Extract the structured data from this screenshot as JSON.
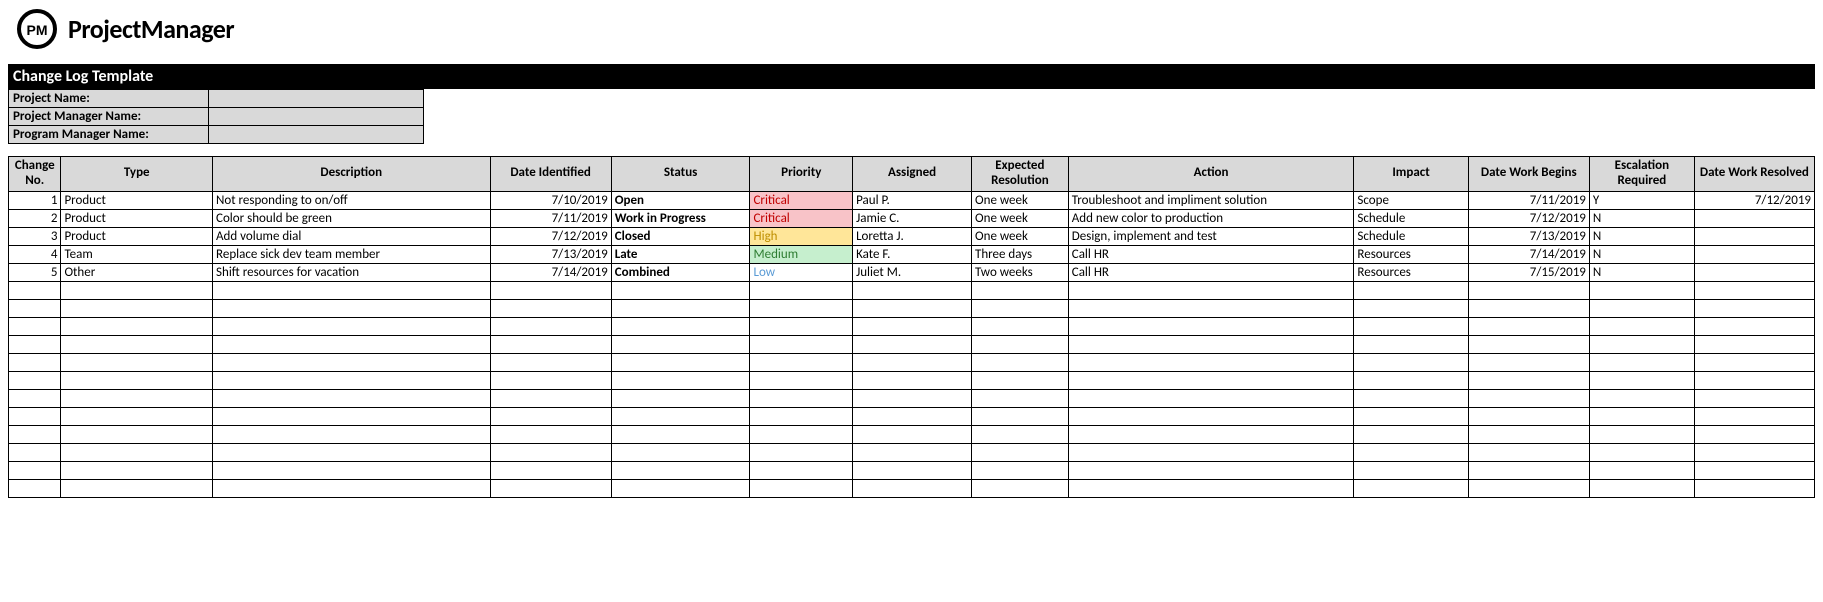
{
  "brand": "ProjectManager",
  "title": "Change Log Template",
  "meta": {
    "project_label": "Project Name:",
    "project_value": "",
    "pm_label": "Project Manager Name:",
    "pm_value": "",
    "pgm_label": "Program Manager Name:",
    "pgm_value": ""
  },
  "headers": {
    "no": "Change No.",
    "type": "Type",
    "desc": "Description",
    "date": "Date Identified",
    "status": "Status",
    "prio": "Priority",
    "assign": "Assigned",
    "res": "Expected Resolution",
    "action": "Action",
    "impact": "Impact",
    "begin": "Date Work Begins",
    "esc": "Escalation Required",
    "resolv": "Date Work Resolved"
  },
  "rows": [
    {
      "no": "1",
      "type": "Product",
      "desc": "Not responding to on/off",
      "date": "7/10/2019",
      "status": "Open",
      "prio": "Critical",
      "assign": "Paul P.",
      "res": "One week",
      "action": "Troubleshoot and impliment solution",
      "impact": "Scope",
      "begin": "7/11/2019",
      "esc": "Y",
      "resolv": "7/12/2019"
    },
    {
      "no": "2",
      "type": "Product",
      "desc": "Color should be green",
      "date": "7/11/2019",
      "status": "Work in Progress",
      "prio": "Critical",
      "assign": "Jamie C.",
      "res": "One week",
      "action": "Add new color to production",
      "impact": "Schedule",
      "begin": "7/12/2019",
      "esc": "N",
      "resolv": ""
    },
    {
      "no": "3",
      "type": "Product",
      "desc": "Add volume dial",
      "date": "7/12/2019",
      "status": "Closed",
      "prio": "High",
      "assign": "Loretta J.",
      "res": "One week",
      "action": "Design, implement and test",
      "impact": "Schedule",
      "begin": "7/13/2019",
      "esc": "N",
      "resolv": ""
    },
    {
      "no": "4",
      "type": "Team",
      "desc": "Replace sick dev team member",
      "date": "7/13/2019",
      "status": "Late",
      "prio": "Medium",
      "assign": "Kate F.",
      "res": "Three days",
      "action": "Call HR",
      "impact": "Resources",
      "begin": "7/14/2019",
      "esc": "N",
      "resolv": ""
    },
    {
      "no": "5",
      "type": "Other",
      "desc": "Shift resources for vacation",
      "date": "7/14/2019",
      "status": "Combined",
      "prio": "Low",
      "assign": "Juliet M.",
      "res": "Two weeks",
      "action": "Call HR",
      "impact": "Resources",
      "begin": "7/15/2019",
      "esc": "N",
      "resolv": ""
    }
  ],
  "empty_rows": 12
}
